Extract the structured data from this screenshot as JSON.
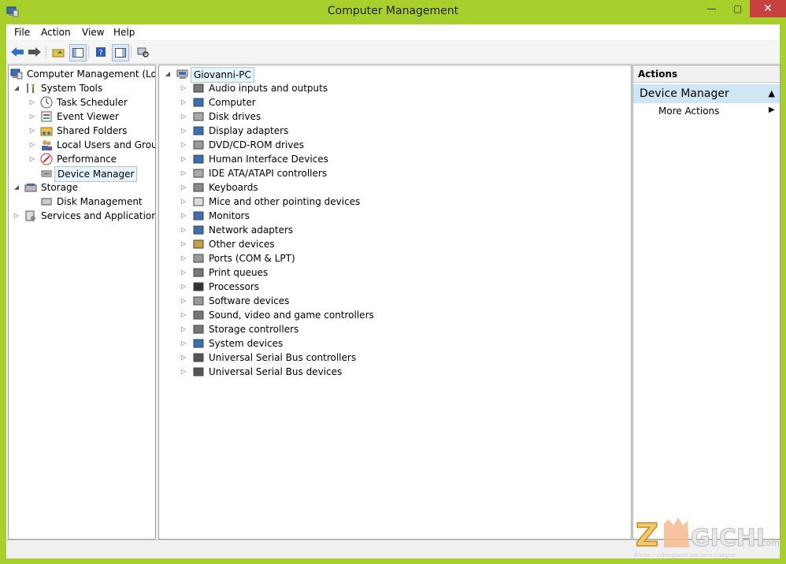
{
  "window": {
    "title": "Computer Management",
    "minimize": "—",
    "maximize": "▢",
    "close": "✕"
  },
  "menu": [
    "File",
    "Action",
    "View",
    "Help"
  ],
  "toolbar": {
    "buttons": [
      "back-arrow-icon",
      "forward-arrow-icon",
      "up-folder-icon",
      "show-hide-tree-icon",
      "help-icon",
      "action-pane-icon",
      "scan-hardware-icon"
    ]
  },
  "left_tree": {
    "root": "Computer Management (Local",
    "system_tools": "System Tools",
    "task_scheduler": "Task Scheduler",
    "event_viewer": "Event Viewer",
    "shared_folders": "Shared Folders",
    "local_users": "Local Users and Groups",
    "performance": "Performance",
    "device_manager": "Device Manager",
    "storage": "Storage",
    "disk_management": "Disk Management",
    "services_apps": "Services and Applications"
  },
  "device_tree": {
    "root": "Giovanni-PC",
    "categories": [
      "Audio inputs and outputs",
      "Computer",
      "Disk drives",
      "Display adapters",
      "DVD/CD-ROM drives",
      "Human Interface Devices",
      "IDE ATA/ATAPI controllers",
      "Keyboards",
      "Mice and other pointing devices",
      "Monitors",
      "Network adapters",
      "Other devices",
      "Ports (COM & LPT)",
      "Print queues",
      "Processors",
      "Software devices",
      "Sound, video and game controllers",
      "Storage controllers",
      "System devices",
      "Universal Serial Bus controllers",
      "Universal Serial Bus devices"
    ]
  },
  "actions": {
    "header": "Actions",
    "group": "Device Manager",
    "more": "More Actions"
  },
  "watermark": {
    "brand": "ZOGICHI",
    "suffix": ".com",
    "tagline": "Anche i videogiochi lasciano il segno"
  },
  "colors": {
    "frame": "#a8cf2c",
    "close": "#c7413f",
    "selection": "#cfe6f5"
  }
}
